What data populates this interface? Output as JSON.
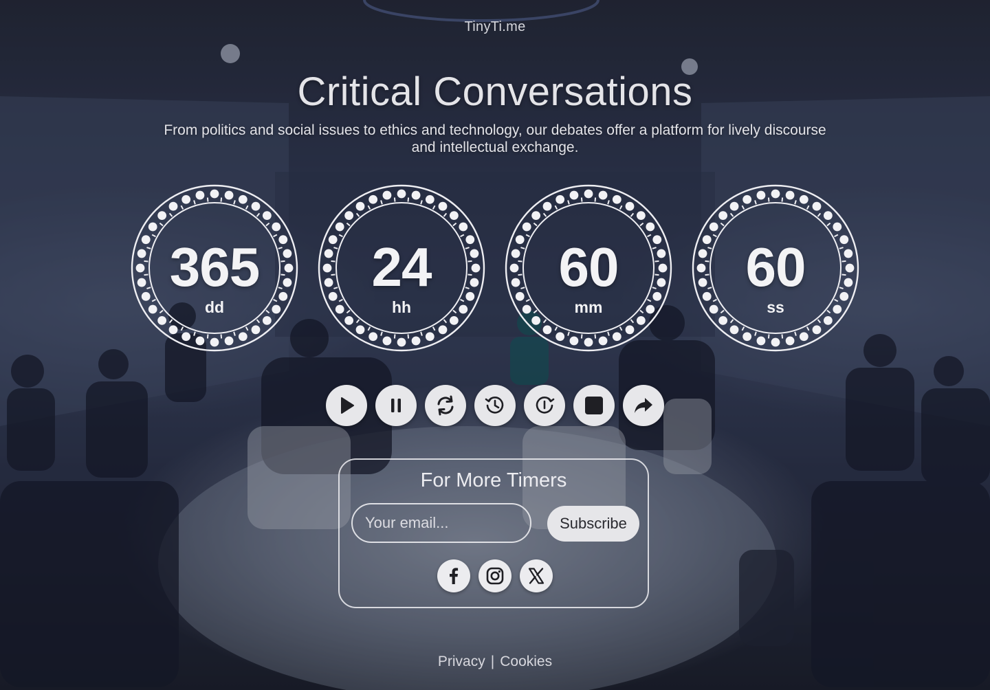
{
  "brand": "TinyTi.me",
  "title": "Critical Conversations",
  "subtitle": "From politics and social issues to ethics and technology, our debates offer a platform for lively discourse and intellectual exchange.",
  "countdown": [
    {
      "value": "365",
      "unit": "dd"
    },
    {
      "value": "24",
      "unit": "hh"
    },
    {
      "value": "60",
      "unit": "mm"
    },
    {
      "value": "60",
      "unit": "ss"
    }
  ],
  "controls": [
    "play-icon",
    "pause-icon",
    "refresh-icon",
    "history-icon",
    "restore-icon",
    "stop-icon",
    "share-icon"
  ],
  "newsletter": {
    "title": "For More Timers",
    "email_placeholder": "Your email...",
    "subscribe_label": "Subscribe"
  },
  "social": [
    "facebook-icon",
    "instagram-icon",
    "x-icon"
  ],
  "footer": {
    "privacy": "Privacy",
    "separator": "|",
    "cookies": "Cookies"
  },
  "colors": {
    "text": "#e9e9ec",
    "button_bg": "#e7e7ea",
    "icon": "#1f1f24"
  }
}
